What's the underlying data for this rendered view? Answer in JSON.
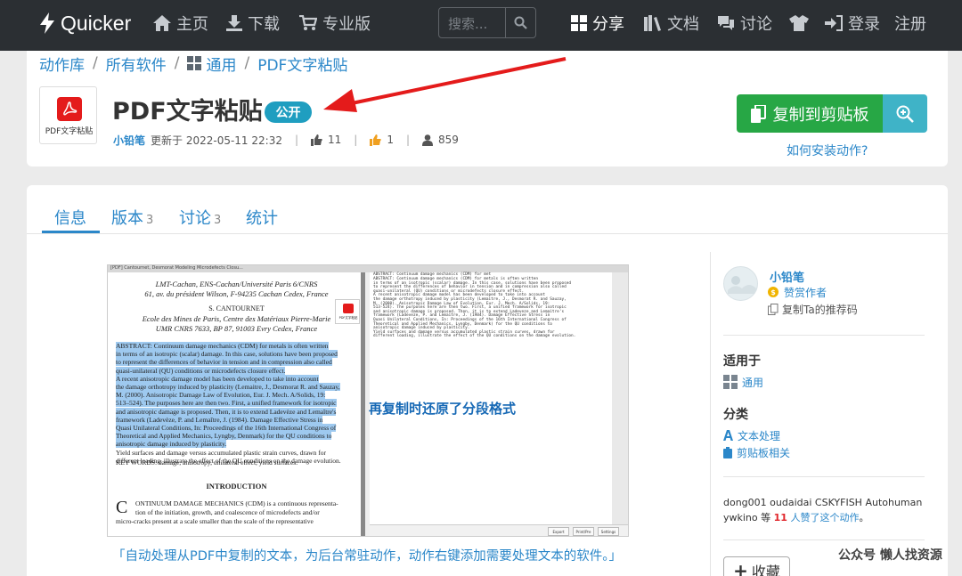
{
  "navbar": {
    "brand": "Quicker",
    "links": {
      "home": "主页",
      "download": "下载",
      "pro": "专业版",
      "share": "分享",
      "docs": "文档",
      "discuss": "讨论",
      "login": "登录",
      "register": "注册"
    },
    "search_placeholder": "搜索..."
  },
  "breadcrumb": {
    "library": "动作库",
    "all_software": "所有软件",
    "general": "通用",
    "current": "PDF文字粘贴"
  },
  "action": {
    "icon_caption": "PDF文字粘贴",
    "title": "PDF文字粘贴",
    "visibility": "公开",
    "author": "小铅笔",
    "updated": "更新于 2022-05-11 22:32",
    "likes": "11",
    "thumbs": "1",
    "users": "859"
  },
  "buttons": {
    "copy": "复制到剪贴板",
    "install_help": "如何安装动作?"
  },
  "tabs": [
    {
      "label": "信息",
      "count": ""
    },
    {
      "label": "版本",
      "count": "3"
    },
    {
      "label": "讨论",
      "count": "3"
    },
    {
      "label": "统计",
      "count": ""
    }
  ],
  "screenshot": {
    "window_title": "[PDF] Cantournet, Desmorat Modeling Microdefects Closu...",
    "affil1": "LMT-Cachan, ENS-Cachan/Université Paris 6/CNRS",
    "affil2": "61, av. du président Wilson, F-94235 Cachan Cedex, France",
    "author2": "S. CANTOURNET",
    "affil3": "Ecole des Mines de Paris, Centre des Matériaux Pierre-Marie",
    "affil4": "UMR CNRS 7633, BP 87, 91003 Evry Cedex, France",
    "abstract_lines": [
      "ABSTRACT: Continuum damage mechanics (CDM) for metals is often written",
      "in terms of an isotropic (scalar) damage. In this case, solutions have been proposed",
      "to represent the differences of behavior in tension and in compression also called",
      "quasi-unilateral (QU) conditions or microdefects closure effect.",
      "   A recent anisotropic damage model has been developed to take into account",
      "the damage orthotropy induced by plasticity (Lemaitre, J., Desmorat R. and Sauzay,",
      "M. (2000). Anisotropic Damage Law of Evolution, Eur. J. Mech. A/Solids, 19:",
      "513–524). The purposes here are then two. First, a unified framework for isotropic",
      "and anisotropic damage is proposed. Then, it is to extend Ladevèze and Lemaître's",
      "framework (Ladevèze, P. and Lemaître, J. (1984). Damage Effective Stress in",
      "Quasi Unilateral Conditions, In: Proceedings of the 16th International Congress of",
      "Theoretical and Applied Mechanics, Lyngby, Denmark) for the QU conditions to",
      "anisotropic damage induced by plasticity.",
      "   Yield surfaces and damage versus accumulated plastic strain curves, drawn for",
      "different loading, illustrate the effect of the QU conditions on the damage evolution."
    ],
    "keywords": "KEY WORDS: damage, anisotropy, unilateral effect, yield surfaces.",
    "intro_heading": "INTRODUCTION",
    "intro_lines": [
      "ONTINUUM DAMAGE MECHANICS (CDM) is a continuous representa-",
      "tion of the initiation, growth, and coalescence of microdefects and/or",
      "micro-cracks present at a scale smaller than the scale of the representative"
    ],
    "mini_icon_caption": "PDF文字粘贴",
    "right_header": "ABSTRACT: Continuum damage mechanics (CDM) for met",
    "right_lines": [
      "ABSTRACT: Continuum damage mechanics (CDM) for metals is often written",
      "in terms of an isotropic (scalar) damage. In this case, solutions have been proposed",
      "to represent the differences of behavior in tension and in compression also called",
      "quasi-unilateral (QU) conditions or microdefects closure effect.",
      "A recent anisotropic damage model has been developed to take into account",
      "the damage orthotropy induced by plasticity (Lemaitre, J., Desmorat R. and Sauzay,",
      "M. (2000). Anisotropic Damage Law of Evolution, Eur. J. Mech. A/Solids, 19:",
      "513-524). The purposes here are then two. First, a unified framework for isotropic",
      "and anisotropic damage is proposed. Then, it is to extend Ladeveze and Lemaitre's",
      "framework (Ladeveze, P. and Lemaitre, J. (1984). Damage Effective Stress in",
      "Quasi Unilateral Conditions, In: Proceedings of the 16th International Congress of",
      "Theoretical and Applied Mechanics, Lyngby, Denmark) for the QU conditions to",
      "anisotropic damage induced by plasticity.",
      "Yield surfaces and damage versus accumulated plastic strain curves, drawn for",
      "different loading, illustrate the effect of the QU conditions on the damage evolution."
    ],
    "overlay_caption": "再复制时还原了分段格式",
    "footer_buttons": [
      "Export",
      "Print/Pre",
      "Settings"
    ]
  },
  "image_caption": "「自动处理从PDF中复制的文本，为后台常驻动作，动作右键添加需要处理文本的软件。」",
  "sidebar": {
    "avatar_text": "小铅笔头像",
    "author": "小铅笔",
    "sponsor": "赞赏作者",
    "refcode": "复制Ta的推荐码",
    "applies_heading": "适用于",
    "applies_item": "通用",
    "category_heading": "分类",
    "category_items": [
      "文本处理",
      "剪贴板相关"
    ],
    "likers_names": "dong001 oudaidai CSKYFISH Autohuman ywkino",
    "likers_mid": "等",
    "likers_count": "11",
    "likers_tail": "人赞了这个动作",
    "likers_end": "。",
    "favorite": "收藏"
  },
  "watermark": "公众号 懒人找资源",
  "colors": {
    "navbar": "#2b2f33",
    "link": "#2b87c9",
    "copy_button": "#27a745",
    "zoom_button": "#3fb3c7",
    "badge": "#1f9ec0",
    "arrow": "#e41b1b"
  }
}
